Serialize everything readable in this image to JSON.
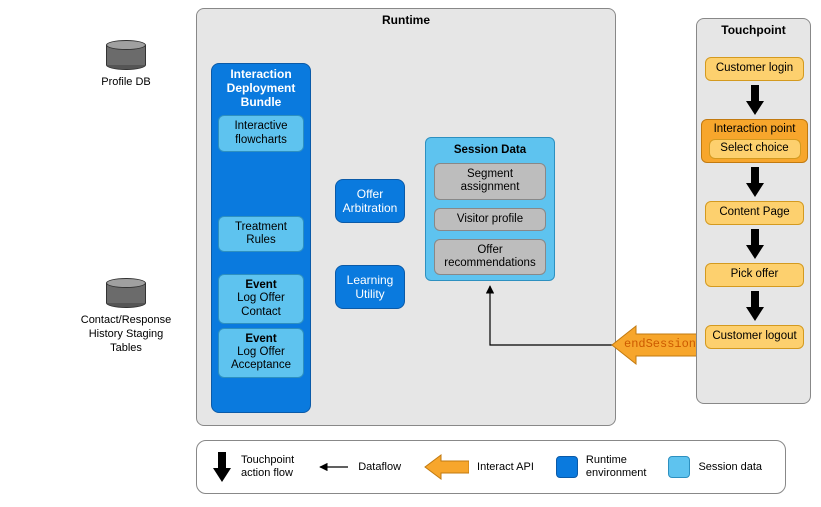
{
  "databases": {
    "profile": {
      "label": "Profile DB"
    },
    "ch": {
      "label": "Contact/Response\nHistory Staging\nTables"
    }
  },
  "runtime": {
    "title": "Runtime",
    "bundle": {
      "title": "Interaction\nDeployment\nBundle",
      "flowcharts": "Interactive\nflowcharts",
      "treatment": "Treatment\nRules",
      "event1_title": "Event",
      "event1_body": "Log Offer\nContact",
      "event2_title": "Event",
      "event2_body": "Log Offer\nAcceptance"
    },
    "offer_arb": "Offer\nArbitration",
    "learning": "Learning\nUtility",
    "session": {
      "title": "Session Data",
      "segment": "Segment\nassignment",
      "visitor": "Visitor profile",
      "recs": "Offer\nrecommendations"
    }
  },
  "touchpoint": {
    "title": "Touchpoint",
    "login": "Customer login",
    "ip": "Interaction point",
    "select": "Select choice",
    "content": "Content Page",
    "pick": "Pick offer",
    "logout": "Customer logout"
  },
  "api": {
    "endSession": "endSession"
  },
  "legend": {
    "action_flow": "Touchpoint\naction flow",
    "dataflow": "Dataflow",
    "interact_api": "Interact API",
    "runtime_env": "Runtime\nenvironment",
    "session_data": "Session data"
  },
  "chart_data": {
    "type": "diagram",
    "title": "Runtime / Touchpoint interaction diagram",
    "groups": [
      {
        "id": "runtime",
        "label": "Runtime",
        "nodes": [
          {
            "id": "bundle",
            "label": "Interaction Deployment Bundle",
            "children": [
              {
                "id": "flowcharts",
                "label": "Interactive flowcharts"
              },
              {
                "id": "treatment",
                "label": "Treatment Rules"
              },
              {
                "id": "event_contact",
                "label": "Event: Log Offer Contact"
              },
              {
                "id": "event_accept",
                "label": "Event: Log Offer Acceptance"
              }
            ]
          },
          {
            "id": "offer_arb",
            "label": "Offer Arbitration"
          },
          {
            "id": "learning",
            "label": "Learning Utility"
          },
          {
            "id": "session",
            "label": "Session Data",
            "children": [
              {
                "id": "segment",
                "label": "Segment assignment"
              },
              {
                "id": "visitor",
                "label": "Visitor profile"
              },
              {
                "id": "recs",
                "label": "Offer recommendations"
              }
            ]
          }
        ]
      },
      {
        "id": "touchpoint",
        "label": "Touchpoint",
        "nodes": [
          {
            "id": "login",
            "label": "Customer login"
          },
          {
            "id": "ip",
            "label": "Interaction point",
            "children": [
              {
                "id": "select",
                "label": "Select choice"
              }
            ]
          },
          {
            "id": "content",
            "label": "Content Page"
          },
          {
            "id": "pick",
            "label": "Pick offer"
          },
          {
            "id": "logout",
            "label": "Customer logout"
          }
        ]
      },
      {
        "id": "external",
        "nodes": [
          {
            "id": "profile_db",
            "label": "Profile DB",
            "type": "database"
          },
          {
            "id": "ch_tables",
            "label": "Contact/Response History Staging Tables",
            "type": "database"
          }
        ]
      }
    ],
    "edges": [
      {
        "from": "login",
        "to": "ip",
        "type": "action_flow"
      },
      {
        "from": "ip",
        "to": "content",
        "type": "action_flow"
      },
      {
        "from": "content",
        "to": "pick",
        "type": "action_flow"
      },
      {
        "from": "pick",
        "to": "logout",
        "type": "action_flow"
      },
      {
        "from": "logout",
        "to": "session",
        "type": "interact_api",
        "label": "endSession"
      }
    ],
    "legend": [
      {
        "id": "action_flow",
        "label": "Touchpoint action flow"
      },
      {
        "id": "dataflow",
        "label": "Dataflow"
      },
      {
        "id": "interact_api",
        "label": "Interact API"
      },
      {
        "id": "runtime_env",
        "label": "Runtime environment"
      },
      {
        "id": "session_data",
        "label": "Session data"
      }
    ]
  }
}
